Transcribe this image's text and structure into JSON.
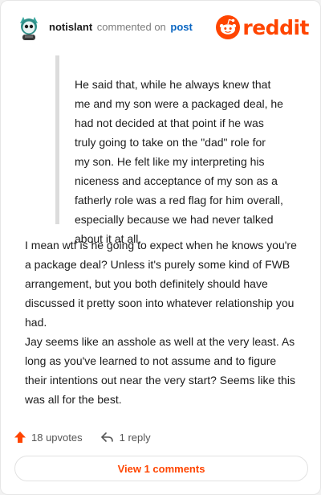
{
  "header": {
    "username": "notislant",
    "action_text": "commented on",
    "target_text": "post",
    "logo_text": "reddit"
  },
  "comment": {
    "quote_text": "He said that, while he always knew that me and my son were a packaged deal, he had not decided at that point if he was truly going to take on the \"dad\" role for my son. He felt like my interpreting his niceness and acceptance of my son as a fatherly role was a red flag for him overall, especially because we had never talked about it at all.",
    "paragraphs": [
      "I mean wtf is he going to expect when he knows you're a package deal? Unless it's purely some kind of FWB arrangement, but you both definitely should have discussed it pretty soon into whatever relationship you had.",
      "Jay seems like an asshole as well at the very least. As long as you've learned to not assume and to figure their intentions out near the very start? Seems like this was all for the best."
    ]
  },
  "actions": {
    "upvotes_label": "18 upvotes",
    "reply_label": "1 reply",
    "view_comments_label": "View 1 comments"
  },
  "icons": {
    "avatar": "avatar",
    "logo": "reddit-logo-icon",
    "upvote": "upvote-arrow-icon",
    "reply": "reply-arrow-icon"
  },
  "colors": {
    "brand": "#ff4500",
    "link": "#0a66c2",
    "muted": "#7c7c7c"
  }
}
